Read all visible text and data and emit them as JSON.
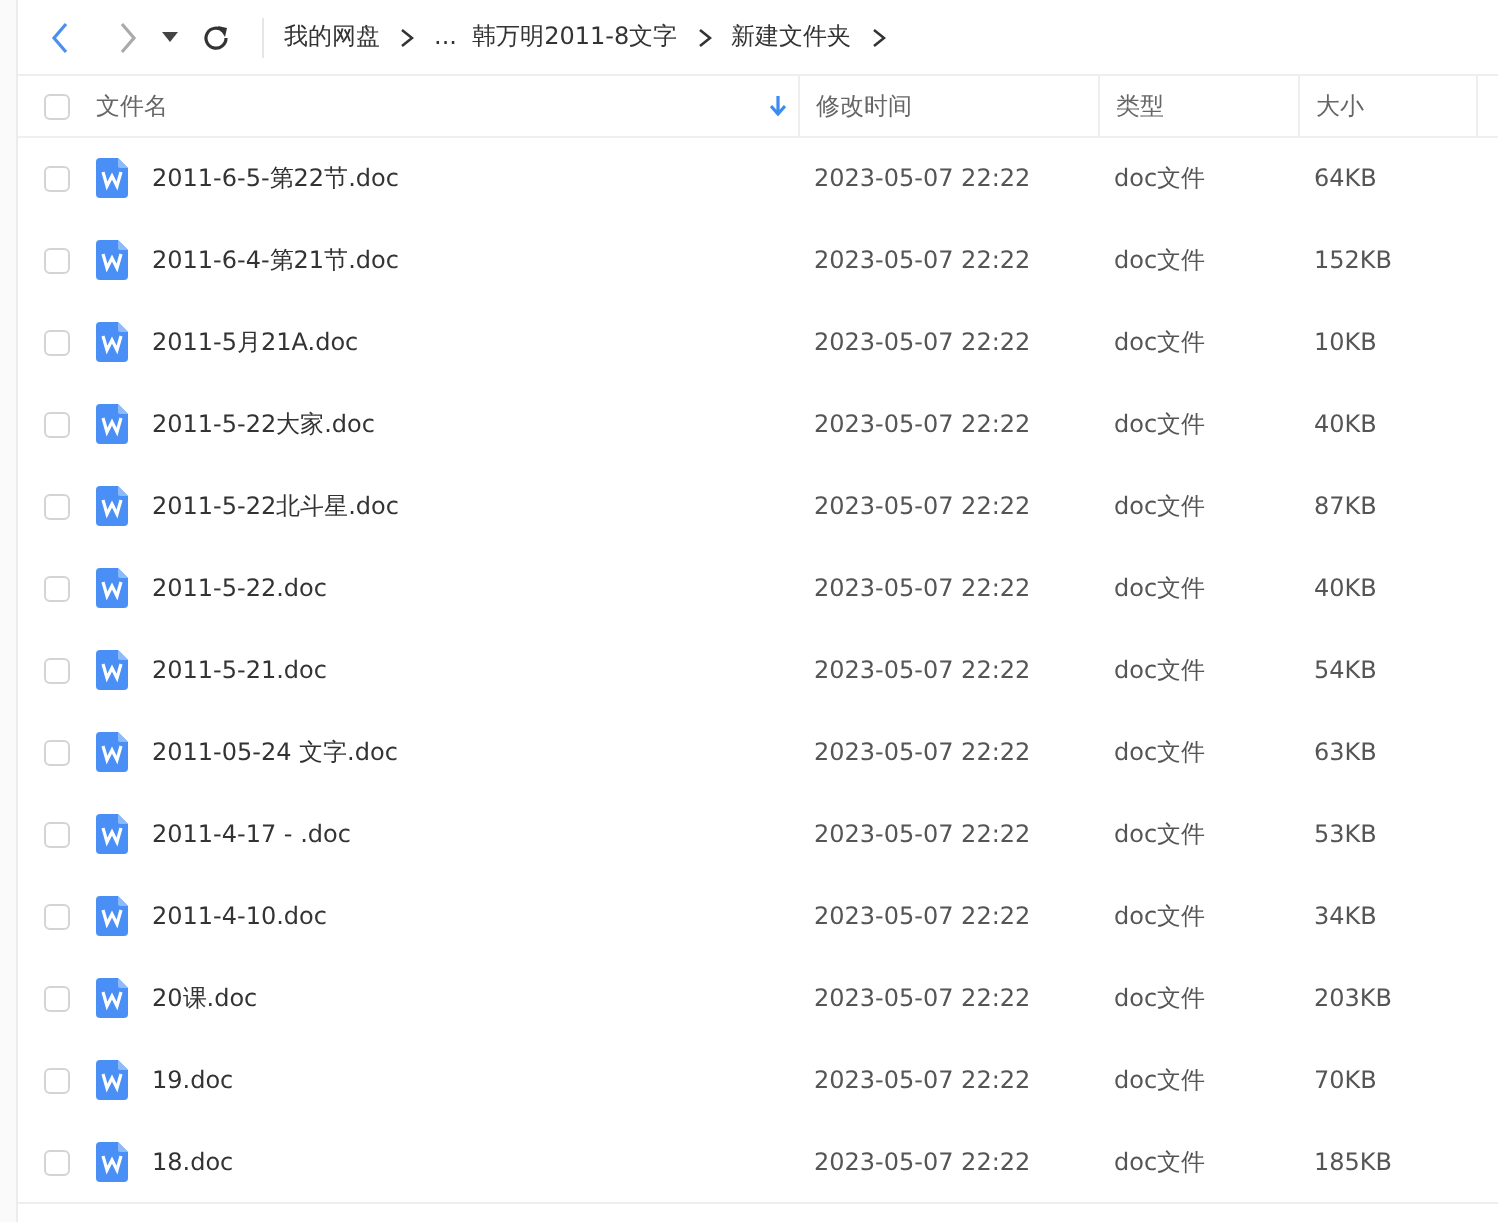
{
  "toolbar": {
    "breadcrumb": [
      {
        "label": "我的网盘"
      },
      {
        "label": "...  韩万明2011-8文字"
      },
      {
        "label": "新建文件夹"
      }
    ]
  },
  "table": {
    "select_all": {
      "checked": false
    },
    "columns": [
      {
        "label": "文件名",
        "sorted": true
      },
      {
        "label": "修改时间",
        "sorted": false
      },
      {
        "label": "类型",
        "sorted": false
      },
      {
        "label": "大小",
        "sorted": false
      }
    ],
    "rows": [
      {
        "name": "2011-6-5-第22节.doc",
        "modified": "2023-05-07 22:22",
        "type": "doc文件",
        "size": "64KB",
        "checked": false
      },
      {
        "name": "2011-6-4-第21节.doc",
        "modified": "2023-05-07 22:22",
        "type": "doc文件",
        "size": "152KB",
        "checked": false
      },
      {
        "name": "2011-5月21A.doc",
        "modified": "2023-05-07 22:22",
        "type": "doc文件",
        "size": "10KB",
        "checked": false
      },
      {
        "name": "2011-5-22大家.doc",
        "modified": "2023-05-07 22:22",
        "type": "doc文件",
        "size": "40KB",
        "checked": false
      },
      {
        "name": "2011-5-22北斗星.doc",
        "modified": "2023-05-07 22:22",
        "type": "doc文件",
        "size": "87KB",
        "checked": false
      },
      {
        "name": "2011-5-22.doc",
        "modified": "2023-05-07 22:22",
        "type": "doc文件",
        "size": "40KB",
        "checked": false
      },
      {
        "name": "2011-5-21.doc",
        "modified": "2023-05-07 22:22",
        "type": "doc文件",
        "size": "54KB",
        "checked": false
      },
      {
        "name": "2011-05-24 文字.doc",
        "modified": "2023-05-07 22:22",
        "type": "doc文件",
        "size": "63KB",
        "checked": false
      },
      {
        "name": "2011-4-17 - .doc",
        "modified": "2023-05-07 22:22",
        "type": "doc文件",
        "size": "53KB",
        "checked": false
      },
      {
        "name": "2011-4-10.doc",
        "modified": "2023-05-07 22:22",
        "type": "doc文件",
        "size": "34KB",
        "checked": false
      },
      {
        "name": "20课.doc",
        "modified": "2023-05-07 22:22",
        "type": "doc文件",
        "size": "203KB",
        "checked": false
      },
      {
        "name": "19.doc",
        "modified": "2023-05-07 22:22",
        "type": "doc文件",
        "size": "70KB",
        "checked": false
      },
      {
        "name": "18.doc",
        "modified": "2023-05-07 22:22",
        "type": "doc文件",
        "size": "185KB",
        "checked": false
      }
    ]
  }
}
